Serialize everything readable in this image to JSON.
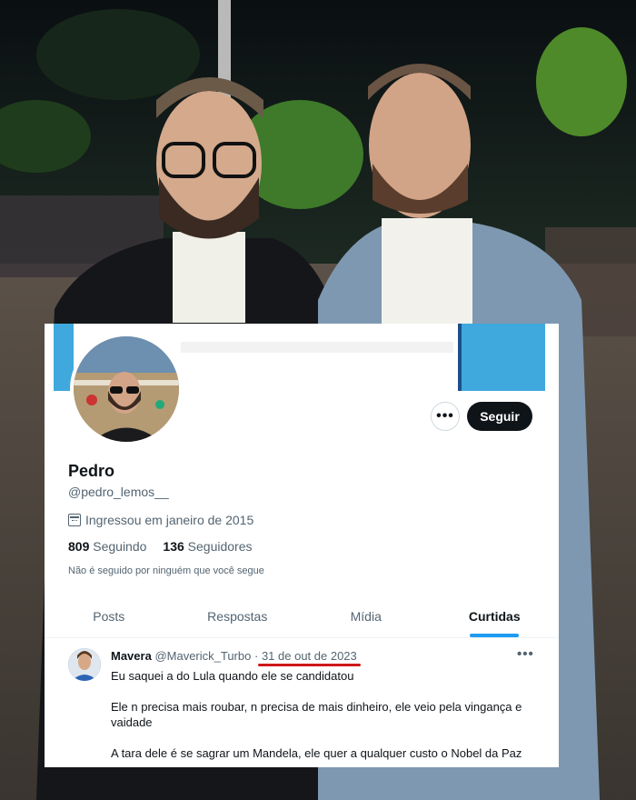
{
  "profile": {
    "name": "Pedro",
    "handle": "@pedro_lemos__",
    "joined": "Ingressou em janeiro de 2015",
    "following_count": "809",
    "following_label": "Seguindo",
    "followers_count": "136",
    "followers_label": "Seguidores",
    "not_followed": "Não é seguido por ninguém que você segue",
    "more_label": "•••",
    "follow_label": "Seguir"
  },
  "tabs": [
    {
      "label": "Posts"
    },
    {
      "label": "Respostas"
    },
    {
      "label": "Mídia"
    },
    {
      "label": "Curtidas"
    }
  ],
  "tweet": {
    "author_name": "Mavera",
    "author_handle": "@Maverick_Turbo",
    "separator": "·",
    "date": "31 de out de 2023",
    "more_label": "•••",
    "paragraphs": [
      "Eu saquei a do Lula quando ele se candidatou",
      "Ele n precisa mais roubar, n precisa de mais dinheiro, ele veio pela vingança e vaidade",
      "A tara dele é se sagrar um Mandela, ele quer a qualquer custo o Nobel da Paz"
    ]
  },
  "colors": {
    "accent": "#1d9bf0",
    "follow_button": "#0f1419",
    "highlight_underline": "#d01818",
    "banner_blue": "#3fa8dc"
  }
}
